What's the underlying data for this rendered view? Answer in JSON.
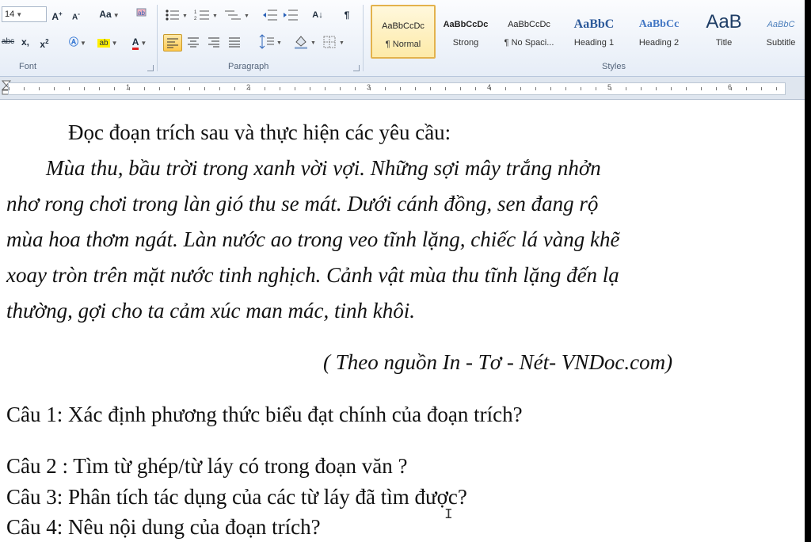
{
  "ribbon": {
    "font": {
      "size": "14",
      "grow_label": "A",
      "shrink_label": "A",
      "case_label": "Aa",
      "strike_label": "abc",
      "sub_label": "x,",
      "sup_label": "x",
      "highlight_label": "ab",
      "color_label": "A",
      "group_label": "Font"
    },
    "paragraph": {
      "sort_label": "A↓",
      "pilcrow": "¶",
      "group_label": "Paragraph"
    },
    "styles": {
      "items": [
        {
          "preview": "AaBbCcDc",
          "name": "¶ Normal"
        },
        {
          "preview": "AaBbCcDc",
          "name": "Strong"
        },
        {
          "preview": "AaBbCcDc",
          "name": "¶ No Spaci..."
        },
        {
          "preview": "AaBbC",
          "name": "Heading 1"
        },
        {
          "preview": "AaBbCc",
          "name": "Heading 2"
        },
        {
          "preview": "AaB",
          "name": "Title"
        },
        {
          "preview": "AaBbC",
          "name": "Subtitle"
        }
      ],
      "group_label": "Styles"
    },
    "ruler_numbers": [
      "1",
      "2",
      "3",
      "4",
      "5",
      "6"
    ]
  },
  "document": {
    "heading": "Đọc đoạn trích sau và thực hiện các yêu cầu:",
    "passage_lines": [
      "Mùa thu, bầu trời trong xanh vời vợi. Những sợi mây trắng nhởn",
      "nhơ rong chơi trong làn gió thu se mát. Dưới cánh đồng, sen đang rộ",
      "mùa hoa thơm ngát. Làn nước ao trong veo tĩnh lặng, chiếc lá vàng khẽ",
      "xoay tròn trên mặt nước tinh nghịch. Cảnh vật mùa thu tĩnh lặng đến lạ",
      "thường, gợi cho ta cảm xúc man mác, tinh khôi."
    ],
    "source": "( Theo nguồn In - Tơ - Nét- VNDoc.com)",
    "questions": [
      "Câu 1: Xác định phương thức biểu đạt chính của đoạn trích?",
      "Câu 2 : Tìm từ ghép/từ láy có trong đoạn văn ?",
      "Câu 3:  Phân tích tác dụng của các từ láy   đã tìm được?",
      "Câu 4: Nêu nội dung của đoạn trích?"
    ]
  }
}
